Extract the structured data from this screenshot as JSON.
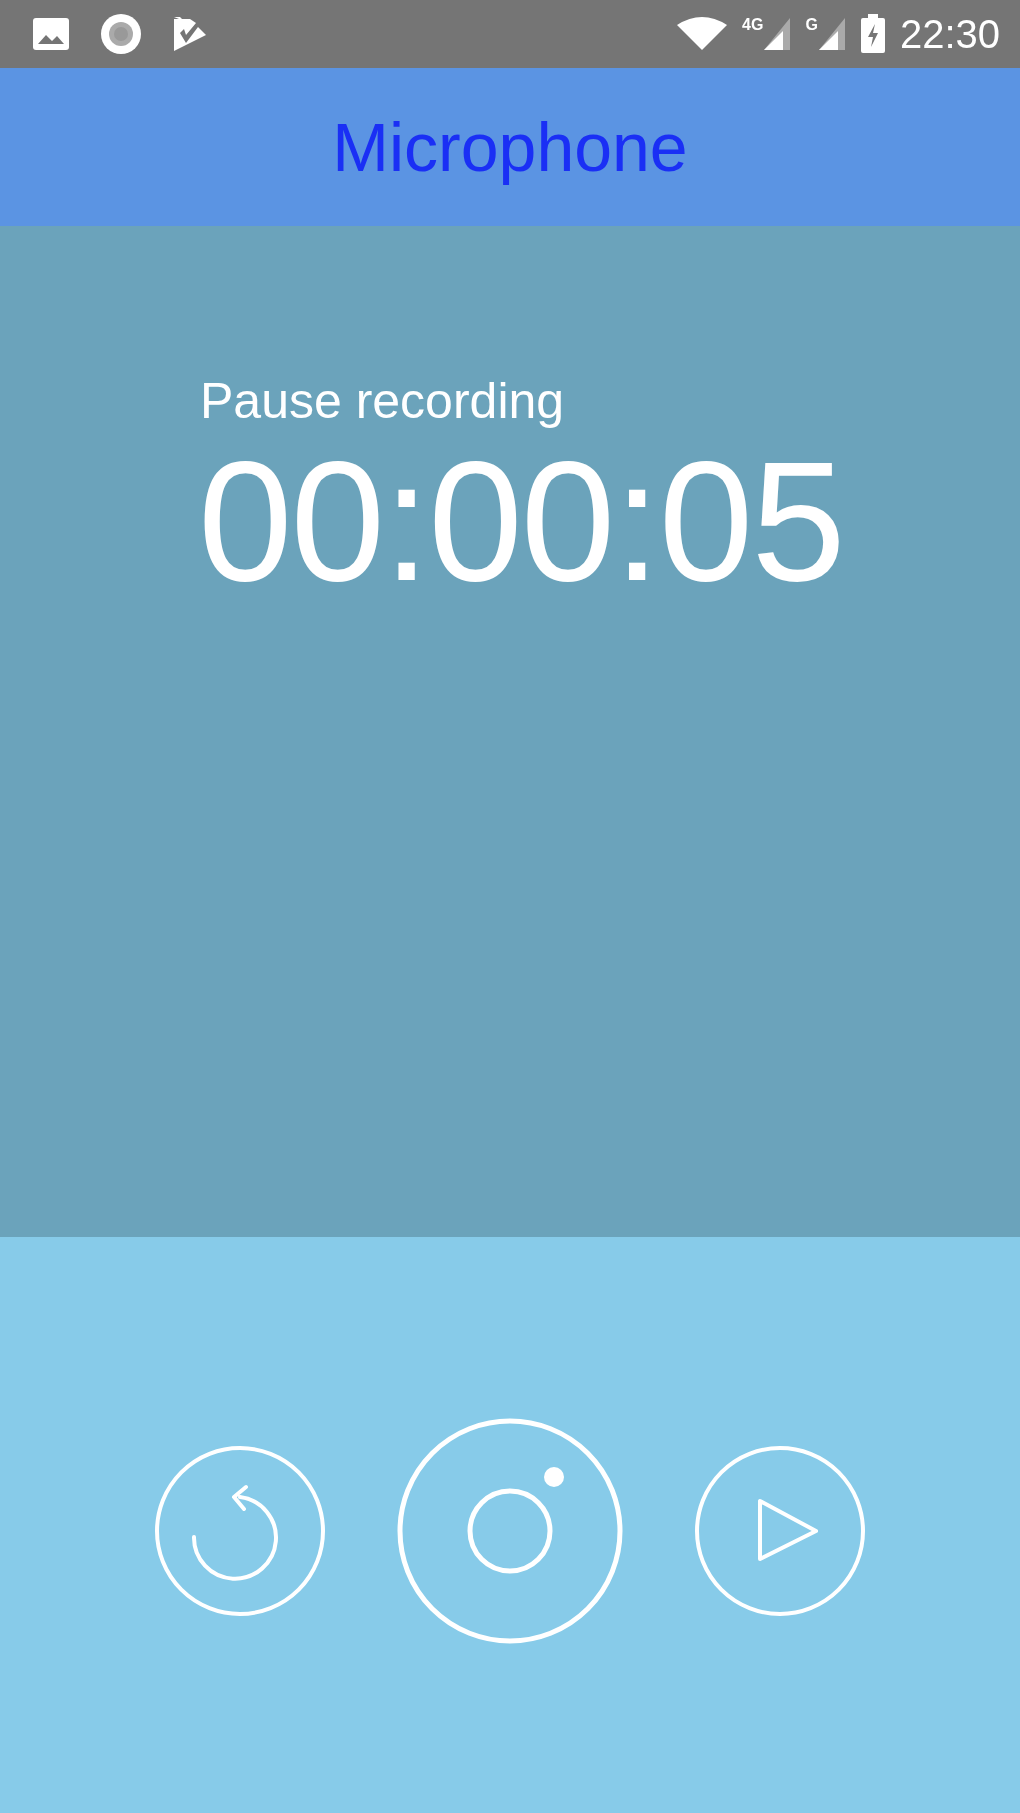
{
  "status_bar": {
    "network_labels": [
      "4G",
      "G"
    ],
    "time": "22:30"
  },
  "app_bar": {
    "title": "Microphone"
  },
  "recording": {
    "status": "Pause recording",
    "timer": "00:00:05"
  },
  "controls": [
    {
      "kind": "reset"
    },
    {
      "kind": "record"
    },
    {
      "kind": "play"
    }
  ]
}
